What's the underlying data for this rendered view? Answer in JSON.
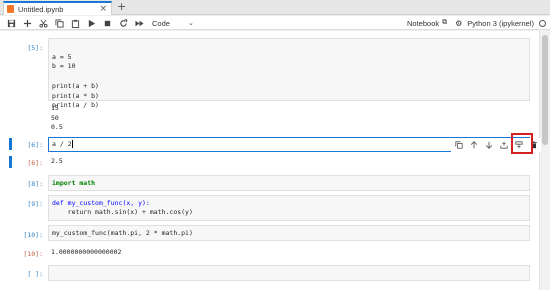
{
  "tab": {
    "title": "Untitled.ipynb",
    "close_glyph": "×",
    "new_tab_glyph": "+"
  },
  "toolbar": {
    "icons": [
      "save-icon",
      "add-cell-icon",
      "cut-icon",
      "copy-icon",
      "paste-icon",
      "run-icon",
      "stop-icon",
      "restart-icon",
      "fast-forward-icon"
    ],
    "cell_type": "Code",
    "notebook_label": "Notebook",
    "kernel_label": "Python 3 (ipykernel)"
  },
  "cells": {
    "c5": {
      "prompt": "[5]:",
      "code": [
        "a = 5",
        "b = 10",
        "",
        "print(a + b)",
        "print(a * b)",
        "print(a / b)"
      ],
      "output": [
        "15",
        "50",
        "0.5"
      ]
    },
    "c6": {
      "prompt": "[6]:",
      "code": "a / 2",
      "out_prompt": "[6]:",
      "output": "2.5"
    },
    "c8": {
      "prompt": "[8]:",
      "code": "import math"
    },
    "c9": {
      "prompt": "[9]:",
      "code": [
        "def my_custom_func(x, y):",
        "    return math.sin(x) + math.cos(y)"
      ]
    },
    "c10": {
      "prompt": "[10]:",
      "code": "my_custom_func(math.pi, 2 * math.pi)",
      "out_prompt": "[10]:",
      "output": "1.0000000000000002"
    },
    "empty": {
      "prompt": "[ ]:"
    }
  },
  "cell_toolbar_icons": [
    "duplicate-icon",
    "move-up-icon",
    "move-down-icon",
    "insert-above-icon",
    "insert-below-icon",
    "delete-icon"
  ],
  "colors": {
    "accent": "#1976d2",
    "highlight": "#d42020",
    "in_prompt": "#307fc1",
    "out_prompt": "#bf5b3d"
  }
}
